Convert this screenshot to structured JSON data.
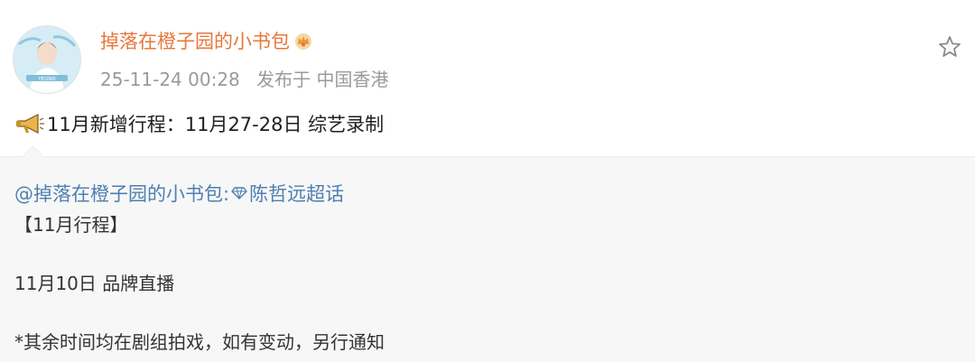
{
  "post": {
    "username": "掉落在橙子园的小书包",
    "avatar_badge_text": "YEOND",
    "vip_icon": "crown-badge-icon",
    "timestamp": "25-11-24 00:28",
    "source": "发布于 中国香港",
    "favorite_icon": "star-icon",
    "megaphone_icon": "megaphone-icon",
    "text": "11月新增行程：11月27-28日 综艺录制"
  },
  "repost": {
    "author_mention": "@掉落在橙子园的小书包:",
    "supertopic_icon": "diamond-icon",
    "supertopic": "陈哲远超话",
    "line1": "【11月行程】",
    "line2": "11月10日 品牌直播",
    "line3": "*其余时间均在剧组拍戏，如有变动，另行通知"
  },
  "colors": {
    "username": "#e8773a",
    "meta": "#9a9a9a",
    "link": "#4f7fb1",
    "repost_bg": "#f7f7f7"
  }
}
